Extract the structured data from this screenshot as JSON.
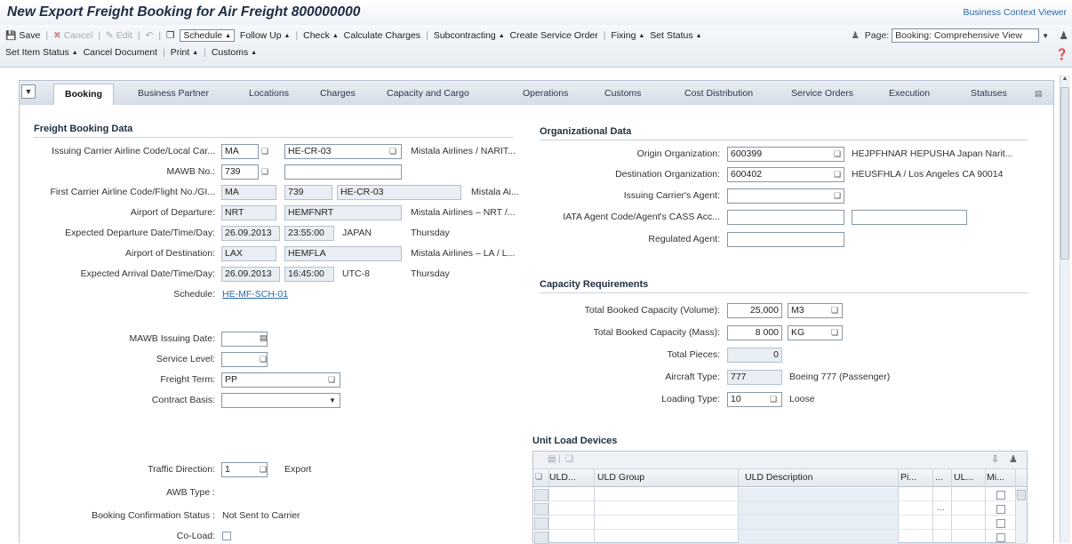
{
  "window": {
    "title": "New Export Freight Booking for Air Freight 800000000",
    "business_context_viewer": "Business Context Viewer"
  },
  "toolbar": {
    "row1": [
      {
        "icon": "save-icon",
        "label": "Save",
        "enabled": true
      },
      {
        "icon": "cancel-icon",
        "label": "Cancel",
        "enabled": false
      },
      {
        "icon": "edit-icon",
        "label": "Edit",
        "enabled": false
      },
      {
        "icon": "undo-icon",
        "label": "",
        "enabled": false
      },
      {
        "icon": "copy-icon",
        "label": "Schedule",
        "menu": true,
        "enabled": true
      },
      {
        "label": "Follow Up",
        "menu": true,
        "enabled": true
      },
      {
        "label": "Check",
        "menu": true,
        "enabled": true
      },
      {
        "label": "Calculate Charges",
        "enabled": true
      },
      {
        "label": "Subcontracting",
        "menu": true,
        "enabled": true
      },
      {
        "label": "Create Service Order",
        "enabled": true
      },
      {
        "label": "Fixing",
        "menu": true,
        "enabled": true
      },
      {
        "label": "Set Status",
        "menu": true,
        "enabled": true
      }
    ],
    "row2": [
      {
        "label": "Set Item Status",
        "menu": true
      },
      {
        "label": "Cancel Document"
      },
      {
        "label": "Print",
        "menu": true
      },
      {
        "label": "Customs",
        "menu": true
      }
    ],
    "page_label": "Page:",
    "page_value": "Booking: Comprehensive View"
  },
  "tabs": [
    {
      "label": "Booking",
      "active": true
    },
    {
      "label": "Business Partner"
    },
    {
      "label": "Locations"
    },
    {
      "label": "Charges"
    },
    {
      "label": "Capacity and Cargo"
    },
    {
      "label": "Operations"
    },
    {
      "label": "Customs"
    },
    {
      "label": "Cost Distribution"
    },
    {
      "label": "Service Orders"
    },
    {
      "label": "Execution"
    },
    {
      "label": "Statuses"
    }
  ],
  "freight_booking": {
    "title": "Freight Booking Data",
    "issuing_carrier": {
      "label": "Issuing Carrier Airline Code/Local Car...",
      "code": "MA",
      "local_carrier": "HE-CR-03",
      "desc": "Mistala Airlines / NARIT..."
    },
    "mawb_no": {
      "label": "MAWB No.:",
      "prefix": "739",
      "number": ""
    },
    "first_carrier": {
      "label": "First Carrier Airline Code/Flight No./GI...",
      "code": "MA",
      "flight": "739",
      "carrier": "HE-CR-03",
      "desc": "Mistala Ai..."
    },
    "airport_departure": {
      "label": "Airport of Departure:",
      "code": "NRT",
      "location": "HEMFNRT",
      "desc": "Mistala Airlines – NRT /..."
    },
    "exp_departure": {
      "label": "Expected Departure Date/Time/Day:",
      "date": "26.09.2013",
      "time": "23:55:00",
      "zone": "JAPAN",
      "day": "Thursday"
    },
    "airport_destination": {
      "label": "Airport of Destination:",
      "code": "LAX",
      "location": "HEMFLA",
      "desc": "Mistala Airlines – LA / L..."
    },
    "exp_arrival": {
      "label": "Expected Arrival Date/Time/Day:",
      "date": "26.09.2013",
      "time": "16:45:00",
      "zone": "UTC-8",
      "day": "Thursday"
    },
    "schedule": {
      "label": "Schedule:",
      "value": "HE-MF-SCH-01"
    },
    "mawb_issuing_date": {
      "label": "MAWB Issuing Date:",
      "value": ""
    },
    "service_level": {
      "label": "Service Level:",
      "value": ""
    },
    "freight_term": {
      "label": "Freight Term:",
      "value": "PP"
    },
    "contract_basis": {
      "label": "Contract Basis:",
      "value": ""
    },
    "traffic_direction": {
      "label": "Traffic Direction:",
      "value": "1",
      "desc": "Export"
    },
    "awb_type": {
      "label": "AWB Type :",
      "value": ""
    },
    "booking_confirmation": {
      "label": "Booking Confirmation Status :",
      "value": "Not Sent to Carrier"
    },
    "co_load": {
      "label": "Co-Load:",
      "checked": false
    }
  },
  "organizational": {
    "title": "Organizational Data",
    "origin_org": {
      "label": "Origin Organization:",
      "value": "600399",
      "desc": "HEJPFHNAR HEPUSHA Japan Narit..."
    },
    "destination_org": {
      "label": "Destination Organization:",
      "value": "600402",
      "desc": "HEUSFHLA / Los Angeles CA 90014"
    },
    "issuing_agent": {
      "label": "Issuing Carrier's Agent:",
      "value": ""
    },
    "iata_code": {
      "label": "IATA Agent Code/Agent's CASS Acc...",
      "value1": "",
      "value2": ""
    },
    "regulated_agent": {
      "label": "Regulated Agent:",
      "value": ""
    }
  },
  "capacity": {
    "title": "Capacity Requirements",
    "volume": {
      "label": "Total Booked Capacity (Volume):",
      "value": "25,000",
      "unit": "M3"
    },
    "mass": {
      "label": "Total Booked Capacity (Mass):",
      "value": "8 000",
      "unit": "KG"
    },
    "pieces": {
      "label": "Total Pieces:",
      "value": "0"
    },
    "aircraft": {
      "label": "Aircraft Type:",
      "value": "777",
      "desc": "Boeing 777 (Passenger)"
    },
    "loading": {
      "label": "Loading Type:",
      "value": "10",
      "desc": "Loose"
    }
  },
  "uld": {
    "title": "Unit Load Devices",
    "columns": [
      "ULD...",
      "ULD Group",
      "ULD Description",
      "Pi...",
      "...",
      "UL...",
      "Mi..."
    ],
    "ellipsis": "..."
  }
}
